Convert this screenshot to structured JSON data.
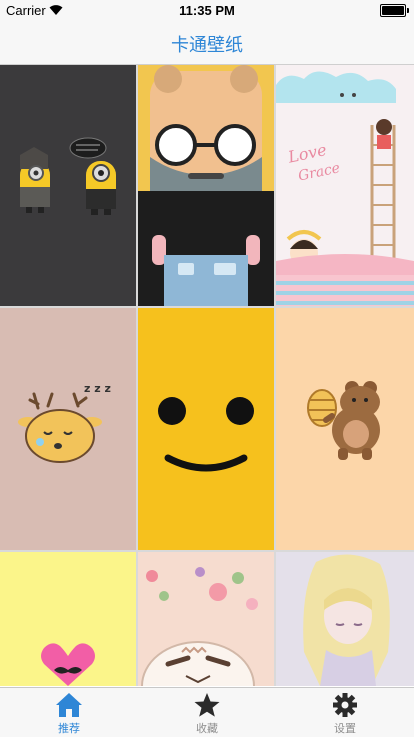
{
  "status_bar": {
    "carrier": "Carrier",
    "time": "11:35 PM"
  },
  "nav_bar": {
    "title": "卡通壁纸",
    "title_color": "#2e86d6"
  },
  "grid": {
    "wallpapers": [
      {
        "name": "minions-dark",
        "bg": "#3b3a3c"
      },
      {
        "name": "bearded-glasses-man",
        "bg": "#f2c64f"
      },
      {
        "name": "love-grace-cloud-ladder",
        "bg": "#f7f0f2",
        "text": "Love Grace"
      },
      {
        "name": "sleepy-deer",
        "bg": "#d8bcb3",
        "text": "z z z"
      },
      {
        "name": "yellow-smiley",
        "bg": "#f6c11d"
      },
      {
        "name": "bear-honeypot",
        "bg": "#fcd6a9"
      },
      {
        "name": "pink-heart-mustache",
        "bg": "#fbf58a"
      },
      {
        "name": "floral-cat",
        "bg": "#f6dccf"
      },
      {
        "name": "anime-girl",
        "bg": "#e4e0ea"
      }
    ]
  },
  "tab_bar": {
    "active_color": "#2e86d6",
    "tabs": [
      {
        "label": "推荐",
        "icon": "home-icon"
      },
      {
        "label": "收藏",
        "icon": "star-icon"
      },
      {
        "label": "设置",
        "icon": "gear-icon"
      }
    ]
  }
}
